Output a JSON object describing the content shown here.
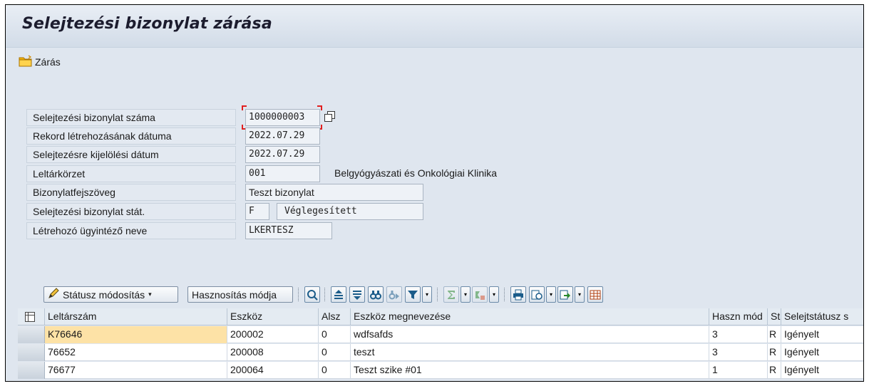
{
  "window": {
    "title": "Selejtezési bizonylat zárása"
  },
  "toolbar": {
    "close_label": "Zárás"
  },
  "form": {
    "doc_number": {
      "label": "Selejtezési bizonylat száma",
      "value": "1000000003"
    },
    "created_date": {
      "label": "Rekord létrehozásának dátuma",
      "value": "2022.07.29"
    },
    "marked_date": {
      "label": "Selejtezésre kijelölési dátum",
      "value": "2022.07.29"
    },
    "inventory_area": {
      "label": "Leltárkörzet",
      "value": "001",
      "description": "Belgyógyászati és Onkológiai Klinika"
    },
    "header_text": {
      "label": "Bizonylatfejszöveg",
      "value": "Teszt bizonylat"
    },
    "status": {
      "label": "Selejtezési bizonylat stát.",
      "code": "F",
      "text": "Véglegesített"
    },
    "creator": {
      "label": "Létrehozó ügyintéző neve",
      "value": "LKERTESZ"
    }
  },
  "grid_toolbar": {
    "status_change_label": "Státusz módosítás",
    "usage_mode_label": "Hasznosítás módja",
    "icons": [
      "details-icon",
      "sort-ascending-icon",
      "sort-descending-icon",
      "find-icon",
      "find-next-icon",
      "filter-icon",
      "sum-icon",
      "subtotal-icon",
      "print-icon",
      "views-icon",
      "export-icon",
      "layout-icon"
    ]
  },
  "table": {
    "columns": [
      "Leltárszám",
      "Eszköz",
      "Alsz",
      "Eszköz megnevezése",
      "Haszn mód",
      "St",
      "Selejtstátusz s"
    ],
    "rows": [
      [
        "K76646",
        "200002",
        "0",
        "wdfsafds",
        "3",
        "R",
        "Igényelt"
      ],
      [
        "76652",
        "200008",
        "0",
        "teszt",
        "3",
        "R",
        "Igényelt"
      ],
      [
        "76677",
        "200064",
        "0",
        "Teszt szike #01",
        "1",
        "R",
        "Igényelt"
      ]
    ]
  },
  "colors": {
    "title_bg": "#d2dce8",
    "form_bg": "#dfe6ef",
    "highlight_cell": "#fde2a6",
    "focus_corner": "#e02020"
  }
}
